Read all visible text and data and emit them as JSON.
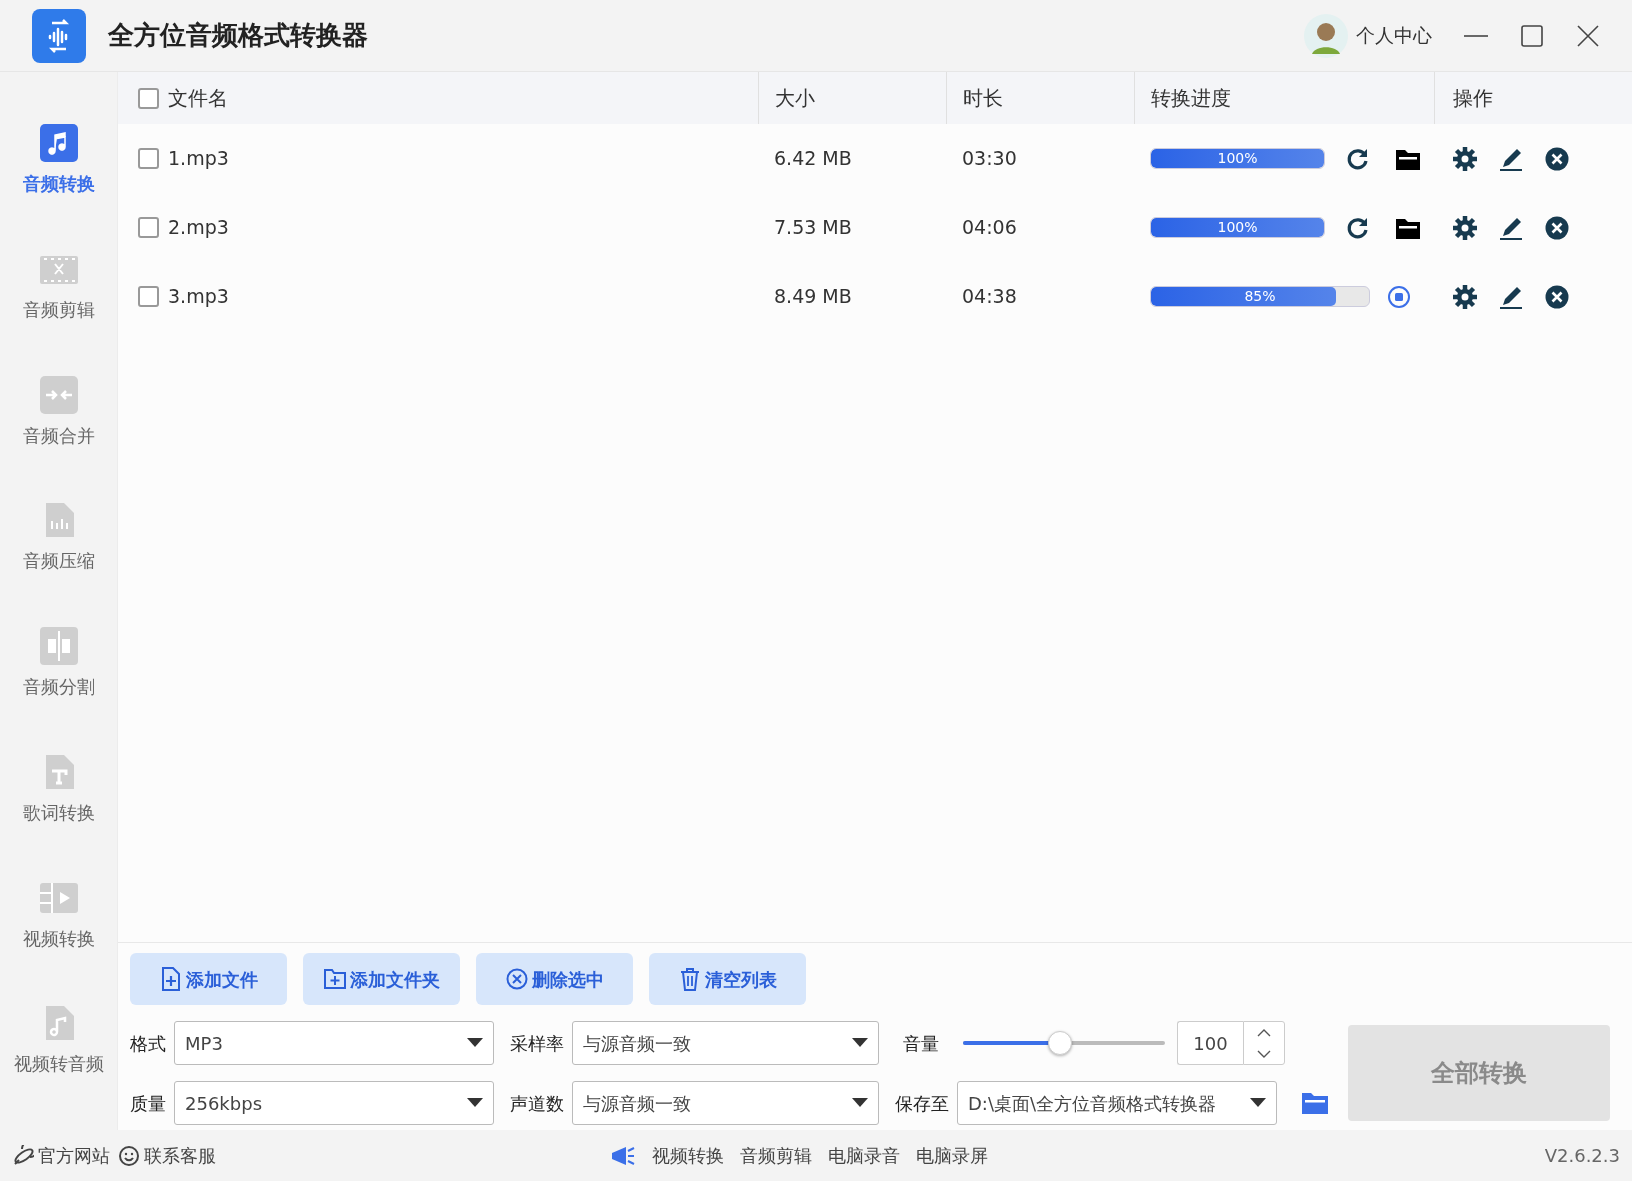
{
  "app": {
    "title": "全方位音频格式转换器",
    "user_label": "个人中心"
  },
  "sidebar": {
    "items": [
      {
        "label": "音频转换",
        "selected": true
      },
      {
        "label": "音频剪辑",
        "selected": false
      },
      {
        "label": "音频合并",
        "selected": false
      },
      {
        "label": "音频压缩",
        "selected": false
      },
      {
        "label": "音频分割",
        "selected": false
      },
      {
        "label": "歌词转换",
        "selected": false
      },
      {
        "label": "视频转换",
        "selected": false
      },
      {
        "label": "视频转音频",
        "selected": false
      }
    ]
  },
  "table": {
    "select_all_checked": false,
    "columns": [
      "文件名",
      "大小",
      "时长",
      "转换进度",
      "操作"
    ],
    "rows": [
      {
        "name": "1.mp3",
        "size": "6.42 MB",
        "duration": "03:30",
        "checked": false,
        "kind": "done",
        "level": 1,
        "progress_label": "100%"
      },
      {
        "name": "2.mp3",
        "size": "7.53 MB",
        "duration": "04:06",
        "checked": false,
        "kind": "done",
        "level": 1,
        "progress_label": "100%"
      },
      {
        "name": "3.mp3",
        "size": "8.49 MB",
        "duration": "04:38",
        "checked": false,
        "kind": "running",
        "level": 0.85,
        "progress_label": "85%"
      }
    ]
  },
  "toolbar": {
    "buttons": [
      "添加文件",
      "添加文件夹",
      "删除选中",
      "清空列表"
    ]
  },
  "settings": {
    "format": {
      "label": "格式",
      "value": "MP3"
    },
    "sample_rate": {
      "label": "采样率",
      "value": "与源音频一致"
    },
    "volume": {
      "label": "音量",
      "level": 0.48,
      "value": "100"
    },
    "quality": {
      "label": "质量",
      "value": "256kbps"
    },
    "channels": {
      "label": "声道数",
      "value": "与源音频一致"
    },
    "save_to": {
      "label": "保存至",
      "value": "D:\\桌面\\全方位音频格式转换器"
    },
    "convert_button": {
      "label": "全部转换",
      "disabled": true
    }
  },
  "footer": {
    "links": [
      "官方网站",
      "联系客服"
    ],
    "tools": [
      "视频转换",
      "音频剪辑",
      "电脑录音",
      "电脑录屏"
    ],
    "version": "V2.6.2.3"
  }
}
